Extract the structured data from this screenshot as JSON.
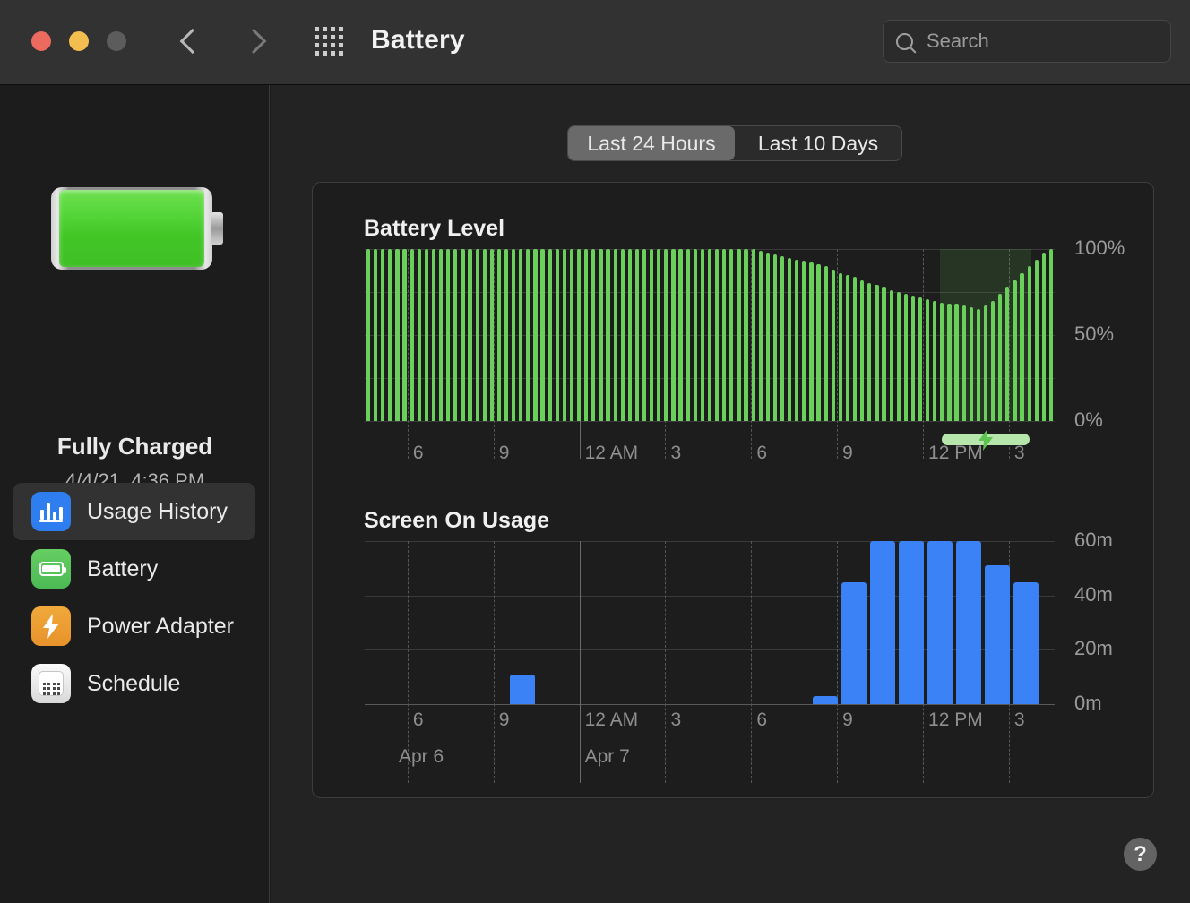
{
  "window": {
    "title": "Battery",
    "traffic_lights": [
      "close",
      "minimize",
      "zoom"
    ],
    "back_icon": "chevron-left-icon",
    "forward_icon": "chevron-right-icon",
    "grid_icon": "show-all-icon"
  },
  "search": {
    "placeholder": "Search",
    "icon": "search-icon"
  },
  "sidebar": {
    "battery_icon": "battery-full-icon",
    "status": "Fully Charged",
    "status_date": "4/4/21, 4:36 PM",
    "items": [
      {
        "label": "Usage History",
        "icon": "usage-history-icon",
        "selected": true
      },
      {
        "label": "Battery",
        "icon": "battery-icon",
        "selected": false
      },
      {
        "label": "Power Adapter",
        "icon": "power-adapter-icon",
        "selected": false
      },
      {
        "label": "Schedule",
        "icon": "schedule-icon",
        "selected": false
      }
    ]
  },
  "segmented": {
    "options": [
      "Last 24 Hours",
      "Last 10 Days"
    ],
    "selected": "Last 24 Hours"
  },
  "help": {
    "label": "?"
  },
  "colors": {
    "battery_green": "#6bcf5c",
    "usage_blue": "#3b82f6",
    "charge_overlay": "#2b4a28",
    "charge_pill": "#b6e6ac",
    "panel_bg": "#1d1d1d",
    "window_bg": "#232323",
    "sidebar_bg": "#1c1c1c",
    "titlebar_bg": "#323232",
    "accent_selected": "#6a6a6a"
  },
  "chart_data": [
    {
      "id": "battery-level",
      "type": "bar",
      "title": "Battery Level",
      "xlabel": "",
      "ylabel": "",
      "ylim": [
        0,
        100
      ],
      "ytick_labels": [
        "100%",
        "50%",
        "0%"
      ],
      "ytick_values": [
        100,
        50,
        0
      ],
      "gridlines": [
        100,
        75,
        50,
        25,
        0
      ],
      "xtick_labels": [
        "6",
        "9",
        "12 AM",
        "3",
        "6",
        "9",
        "12 PM",
        "3"
      ],
      "xtick_hours": [
        6,
        9,
        12,
        15,
        18,
        21,
        24,
        27
      ],
      "bar_color": "#6bcf5c",
      "charging_region": {
        "start_hour": 24.6,
        "end_hour": 27.8,
        "label": "charging"
      },
      "values": [
        100,
        100,
        100,
        100,
        100,
        100,
        100,
        100,
        100,
        100,
        100,
        100,
        100,
        100,
        100,
        100,
        100,
        100,
        100,
        100,
        100,
        100,
        100,
        100,
        100,
        100,
        100,
        100,
        100,
        100,
        100,
        100,
        100,
        100,
        100,
        100,
        100,
        100,
        100,
        100,
        100,
        100,
        100,
        100,
        100,
        100,
        100,
        100,
        100,
        100,
        100,
        100,
        100,
        100,
        99,
        98,
        97,
        96,
        95,
        94,
        93,
        92,
        91,
        90,
        88,
        86,
        85,
        84,
        82,
        80,
        79,
        78,
        76,
        75,
        74,
        73,
        72,
        71,
        70,
        69,
        68,
        68,
        67,
        66,
        65,
        67,
        70,
        74,
        78,
        82,
        86,
        90,
        94,
        98,
        100
      ]
    },
    {
      "id": "screen-on-usage",
      "type": "bar",
      "title": "Screen On Usage",
      "xlabel": "",
      "ylabel": "",
      "ylim": [
        0,
        60
      ],
      "ytick_labels": [
        "60m",
        "40m",
        "20m",
        "0m"
      ],
      "ytick_values": [
        60,
        40,
        20,
        0
      ],
      "xtick_labels": [
        "6",
        "9",
        "12 AM",
        "3",
        "6",
        "9",
        "12 PM",
        "3"
      ],
      "xtick_hours": [
        6,
        9,
        12,
        15,
        18,
        21,
        24,
        27
      ],
      "date_labels": [
        {
          "text": "Apr 6",
          "hour": 5.5
        },
        {
          "text": "Apr 7",
          "hour": 12
        }
      ],
      "bar_color": "#3b82f6",
      "categories": [
        10,
        21,
        22,
        23,
        24,
        25,
        26,
        27
      ],
      "values": [
        11,
        3,
        45,
        60,
        60,
        60,
        60,
        51,
        45
      ],
      "bars": [
        {
          "hour": 10,
          "value": 11
        },
        {
          "hour": 20.6,
          "value": 3
        },
        {
          "hour": 21.6,
          "value": 45
        },
        {
          "hour": 22.6,
          "value": 60
        },
        {
          "hour": 23.6,
          "value": 60
        },
        {
          "hour": 24.6,
          "value": 60
        },
        {
          "hour": 25.6,
          "value": 60
        },
        {
          "hour": 26.6,
          "value": 51
        },
        {
          "hour": 27.6,
          "value": 45
        }
      ]
    }
  ]
}
